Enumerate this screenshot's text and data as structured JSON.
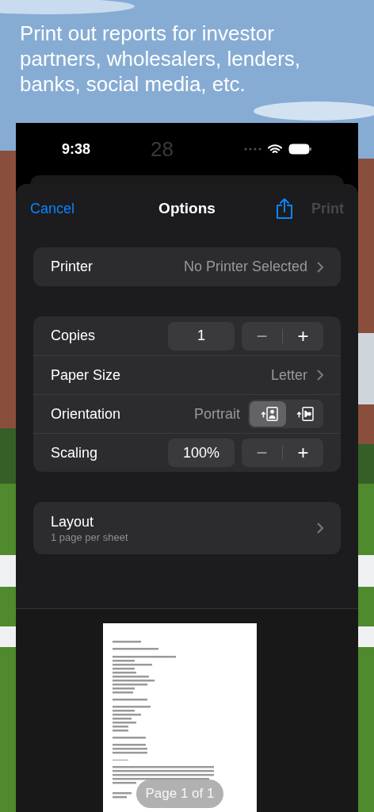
{
  "headline": "Print out reports for investor partners, wholesalers, lenders, banks, social media, etc.",
  "status_bar": {
    "time": "9:38",
    "center": "28"
  },
  "nav": {
    "cancel": "Cancel",
    "title": "Options",
    "print": "Print",
    "print_disabled": true
  },
  "printer": {
    "label": "Printer",
    "value": "No Printer Selected"
  },
  "options": [
    {
      "kind": "stepper",
      "label": "Copies",
      "value": "1",
      "minus": "−",
      "plus": "+"
    },
    {
      "kind": "picker",
      "label": "Paper Size",
      "value": "Letter"
    },
    {
      "kind": "segmented",
      "label": "Orientation",
      "value": "Portrait",
      "segments": [
        {
          "selected": true
        },
        {
          "selected": false
        }
      ]
    },
    {
      "kind": "stepper",
      "label": "Scaling",
      "value": "100%",
      "minus": "−",
      "plus": "+"
    }
  ],
  "layout": {
    "label": "Layout",
    "value": "1 page per sheet"
  },
  "preview": {
    "page_indicator": "Page 1 of 1"
  }
}
